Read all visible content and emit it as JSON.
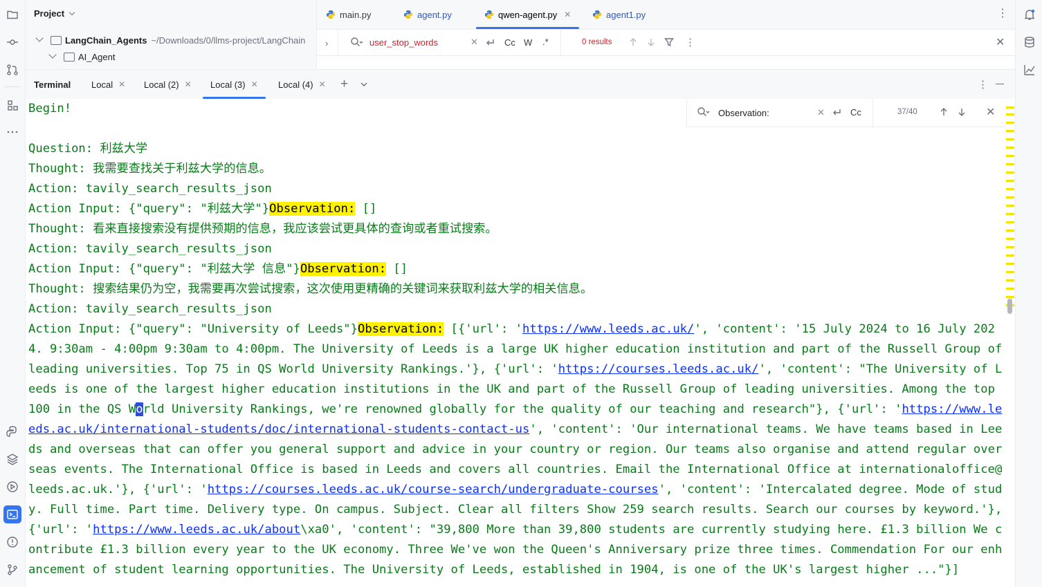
{
  "project": {
    "title": "Project",
    "root_name": "LangChain_Agents",
    "root_path": "~/Downloads/0/llms-project/LangChain",
    "child_folder": "AI_Agent"
  },
  "editor_tabs": [
    {
      "label": "main.py"
    },
    {
      "label": "agent.py"
    },
    {
      "label": "qwen-agent.py"
    },
    {
      "label": "agent1.py"
    }
  ],
  "find_bar": {
    "query": "user_stop_words",
    "results": "0 results",
    "case_label": "Cc",
    "word_label": "W",
    "regex_label": ".*"
  },
  "terminal_tabs": {
    "title": "Terminal",
    "tabs": [
      "Local",
      "Local (2)",
      "Local (3)",
      "Local (4)"
    ],
    "active": "Local (3)"
  },
  "term_search": {
    "query": "Observation:",
    "case_label": "Cc",
    "count": "37/40"
  },
  "terminal": {
    "begin": "Begin!",
    "q_label": "Question: ",
    "q_text": "利兹大学",
    "t1": "Thought: 我需要查找关于利兹大学的信息。",
    "a1": "Action: tavily_search_results_json",
    "ai1_pre": "Action Input: {\"query\": \"利兹大学\"}",
    "obs": "Observation:",
    "obs1_post": " []",
    "t2": "Thought: 看来直接搜索没有提供预期的信息，我应该尝试更具体的查询或者重试搜索。",
    "a2": "Action: tavily_search_results_json",
    "ai2_pre": "Action Input: {\"query\": \"利兹大学 信息\"}",
    "obs2_post": " []",
    "t3": "Thought: 搜索结果仍为空，我需要再次尝试搜索，这次使用更精确的关键词来获取利兹大学的相关信息。",
    "a3": "Action: tavily_search_results_json",
    "ai3_pre": "Action Input: {\"query\": \"University of Leeds\"}",
    "r1_pre": " [{'url': '",
    "url1": "https://www.leeds.ac.uk/",
    "r1_post": "', 'content': '15 July 2024 to 16 July 2024. 9:30am - 4:00pm 9:30am to 4:00pm. The University of Leeds is a large UK higher education institution and part of the Russell Group of leading universities. Top 75 in QS World University Rankings.'}, {'url': '",
    "url2": "https://courses.leeds.ac.uk/",
    "r2_a": "', 'content': \"The University of Leeds is one of the largest higher education institutions in the UK and part of the Russell Group of leading universities. Among the top 100 in the QS W",
    "r2_cursor": "o",
    "r2_b": "rld University Rankings, we're renowned globally for the quality of our teaching and research\"}, {'url': '",
    "url3": "https://www.leeds.ac.uk/international-students/doc/international-students-contact-us",
    "r3_post": "', 'content': 'Our international teams. We have teams based in Leeds and overseas that can offer you general support and advice in your country or region. Our teams also organise and attend regular overseas events. The International Office is based in Leeds and covers all countries. Email the International Office at internationaloffice@leeds.ac.uk.'}, {'url': '",
    "url4": "https://courses.leeds.ac.uk/course-search/undergraduate-courses",
    "r4_post": "', 'content': 'Intercalated degree. Mode of study. Full time. Part time. Delivery type. On campus. Subject. Clear all filters Show 259 search results. Search our courses by keyword.'}, {'url': '",
    "url5": "https://www.leeds.ac.uk/about",
    "r5_post": "\\xa0', 'content': \"39,800 More than 39,800 students are currently studying here. £1.3 billion We contribute £1.3 billion every year to the UK economy. Three We've won the Queen's Anniversary prize three times. Commendation For our enhancement of student learning opportunities. The University of Leeds, established in 1904, is one of the UK's largest higher ...\"}]"
  },
  "colors": {
    "accent": "#3574f0",
    "terminal_text": "#067d17",
    "highlight": "#fff200",
    "link": "#0b2fff",
    "search_red": "#d2212a"
  }
}
